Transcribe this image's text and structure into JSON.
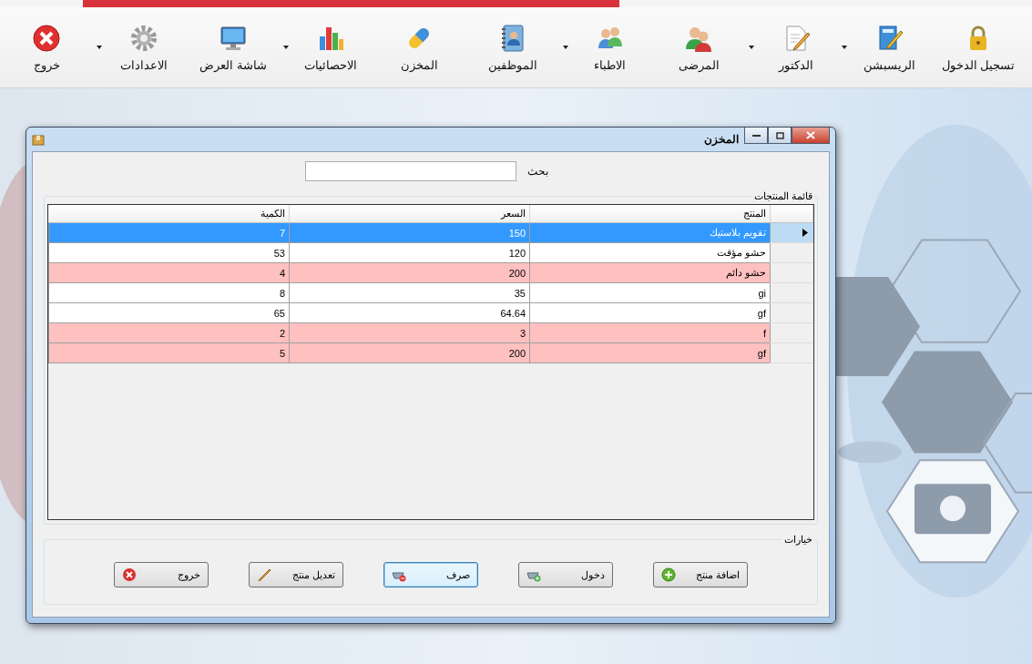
{
  "toolbar": [
    {
      "label": "تسجيل الدخول",
      "has_menu": false
    },
    {
      "label": "الريسبشن",
      "has_menu": true
    },
    {
      "label": "الدكتور",
      "has_menu": true
    },
    {
      "label": "المرضى",
      "has_menu": false
    },
    {
      "label": "الاطباء",
      "has_menu": true
    },
    {
      "label": "الموظفين",
      "has_menu": false
    },
    {
      "label": "المخزن",
      "has_menu": false
    },
    {
      "label": "الاحصائيات",
      "has_menu": true
    },
    {
      "label": "شاشة العرض",
      "has_menu": false
    },
    {
      "label": "الاعدادات",
      "has_menu": true
    },
    {
      "label": "خروج",
      "has_menu": false
    }
  ],
  "window": {
    "title": "المخزن",
    "search": {
      "label": "بحث"
    },
    "products": {
      "title": "قائمة المنتجات",
      "columns": [
        "المنتج",
        "السعر",
        "الكمية"
      ],
      "rows": [
        {
          "cells": [
            "تقويم بلاستيك",
            "150",
            "7"
          ],
          "selected": true,
          "flagged": false
        },
        {
          "cells": [
            "حشو مؤقت",
            "120",
            "53"
          ],
          "selected": false,
          "flagged": false
        },
        {
          "cells": [
            "حشو دائم",
            "200",
            "4"
          ],
          "selected": false,
          "flagged": true
        },
        {
          "cells": [
            "gi",
            "35",
            "8"
          ],
          "selected": false,
          "flagged": false
        },
        {
          "cells": [
            "gf",
            "64.64",
            "65"
          ],
          "selected": false,
          "flagged": false
        },
        {
          "cells": [
            "f",
            "3",
            "2"
          ],
          "selected": false,
          "flagged": true
        },
        {
          "cells": [
            "gf",
            "200",
            "5"
          ],
          "selected": false,
          "flagged": true
        }
      ]
    },
    "options": {
      "title": "خيارات",
      "buttons": [
        {
          "label": "اضافة منتج",
          "focused": false
        },
        {
          "label": "دخول",
          "focused": false
        },
        {
          "label": "صرف",
          "focused": true
        },
        {
          "label": "تعديل منتج",
          "focused": false
        },
        {
          "label": "خروج",
          "focused": false
        }
      ]
    }
  }
}
